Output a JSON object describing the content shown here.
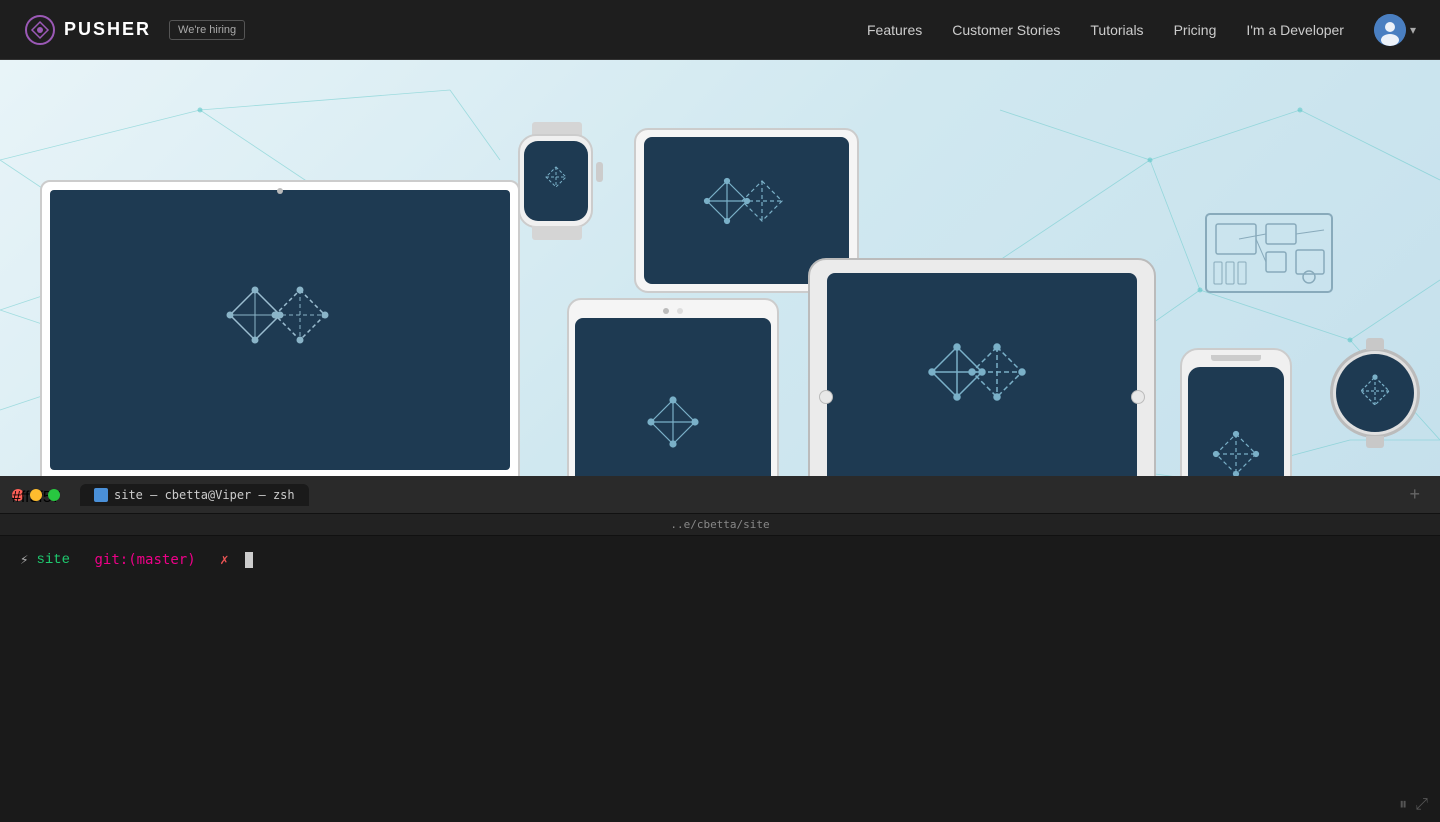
{
  "navbar": {
    "brand": "PUSHER",
    "hiring_label": "We're hiring",
    "nav_items": [
      {
        "id": "features",
        "label": "Features"
      },
      {
        "id": "customer-stories",
        "label": "Customer Stories"
      },
      {
        "id": "tutorials",
        "label": "Tutorials"
      },
      {
        "id": "pricing",
        "label": "Pricing"
      },
      {
        "id": "developer",
        "label": "I'm a Developer"
      }
    ]
  },
  "terminal": {
    "tab_title": "site — cbetta@Viper — zsh",
    "path": "..e/cbetta/site",
    "prompt_site": "site",
    "prompt_git": "git:(master)",
    "prompt_x": "✗",
    "add_tab_label": "+",
    "pause_icon": "⏸",
    "expand_icon": "⤢"
  },
  "colors": {
    "device_bg": "#1e3a52",
    "navbar_bg": "#1e1e1e",
    "terminal_bg": "#1a1a1a",
    "hero_bg": "#ddeef5",
    "traffic_close": "#ff5f57",
    "traffic_min": "#febc2e",
    "traffic_max": "#28c840"
  }
}
